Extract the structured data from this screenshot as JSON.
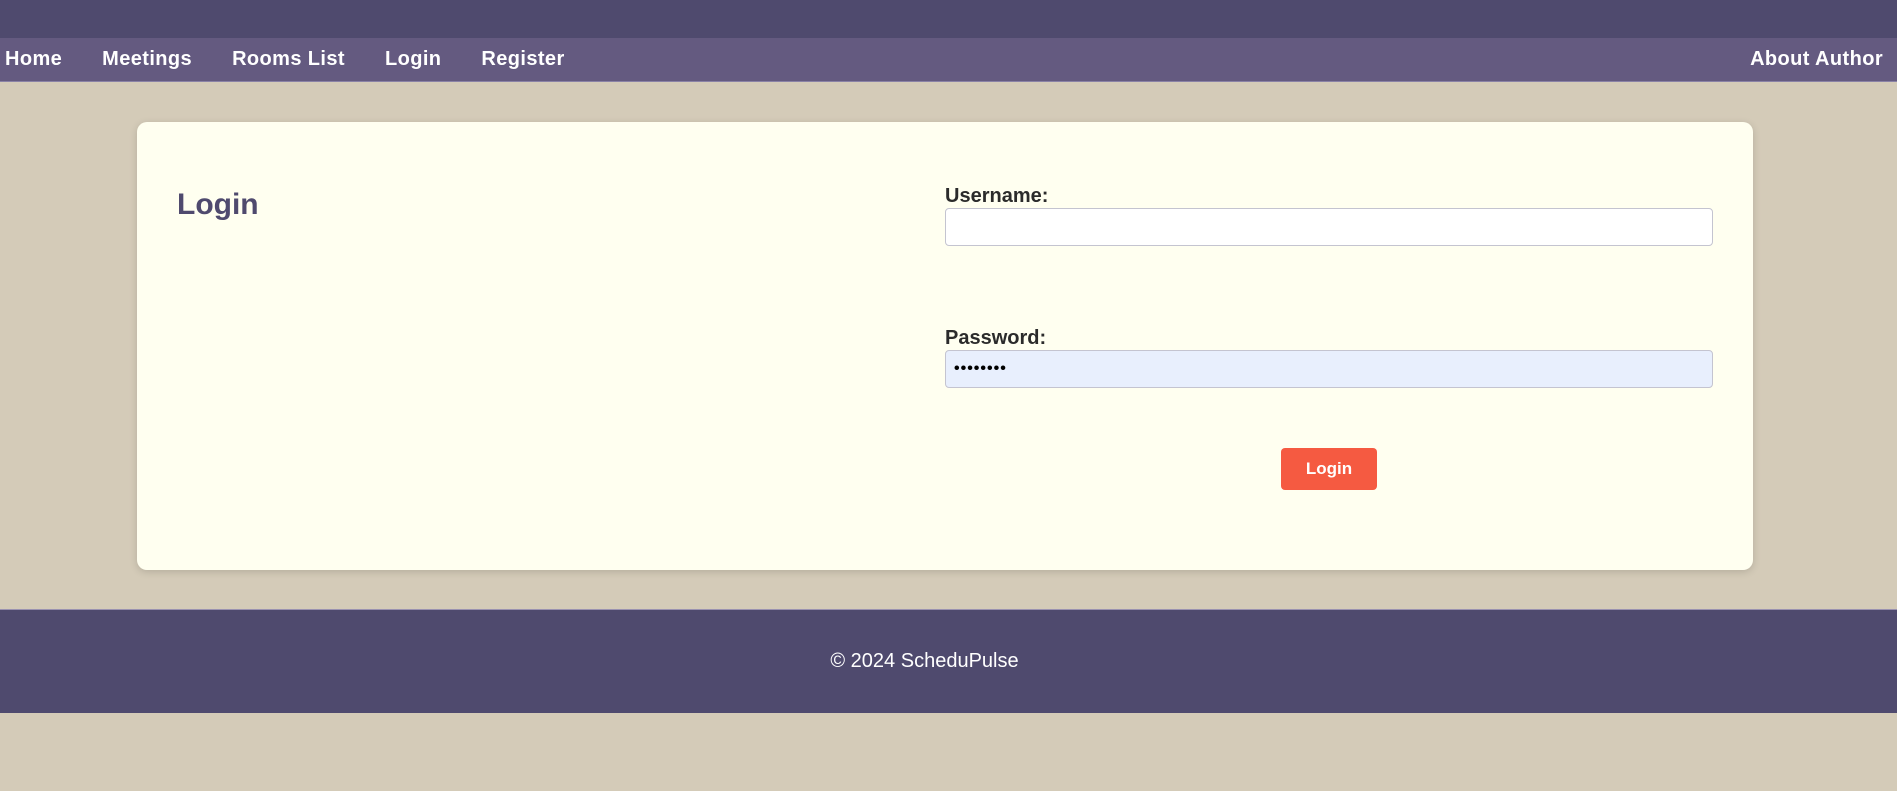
{
  "nav": {
    "items": [
      {
        "label": "Home"
      },
      {
        "label": "Meetings"
      },
      {
        "label": "Rooms List"
      },
      {
        "label": "Login"
      },
      {
        "label": "Register"
      }
    ],
    "about": "About Author"
  },
  "login": {
    "title": "Login",
    "username_label": "Username:",
    "username_value": "",
    "password_label": "Password:",
    "password_value": "••••••••",
    "submit_label": "Login"
  },
  "footer": {
    "text": "© 2024 ScheduPulse"
  },
  "colors": {
    "topbar": "#4f4a6e",
    "navbar": "#645a80",
    "background": "#d4cbb8",
    "card": "#fffff0",
    "accent_button": "#f55a41",
    "title": "#4f4a6e"
  }
}
